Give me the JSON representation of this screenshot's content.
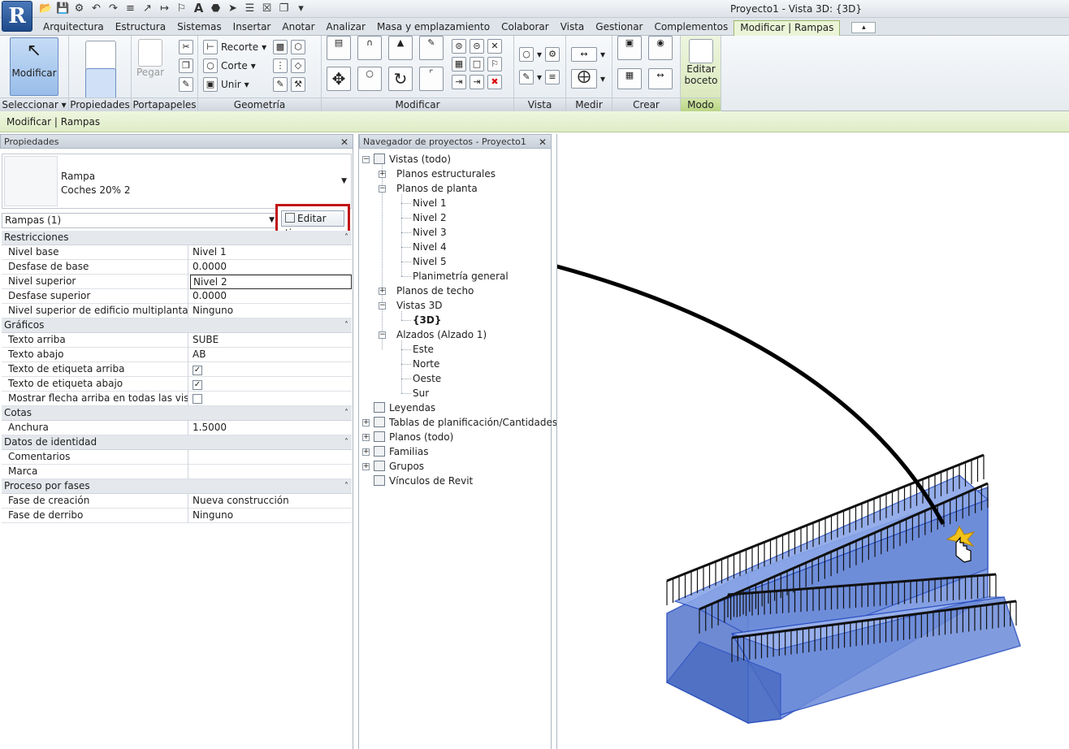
{
  "app": {
    "logo_letter": "R",
    "window_title": "Proyecto1 - Vista 3D: {3D}"
  },
  "qat": {
    "icons": [
      "open-icon",
      "save-icon",
      "sync-icon",
      "undo-icon",
      "redo-icon",
      "measure-icon",
      "dimension-icon",
      "tag-icon",
      "text-icon",
      "3d-view-icon",
      "section-icon",
      "thin-lines-icon",
      "close-hidden-icon",
      "switch-windows-icon",
      "customize-icon"
    ],
    "text_glyph": "A"
  },
  "tabs": [
    "Arquitectura",
    "Estructura",
    "Sistemas",
    "Insertar",
    "Anotar",
    "Analizar",
    "Masa y emplazamiento",
    "Colaborar",
    "Vista",
    "Gestionar",
    "Complementos",
    "Modificar | Rampas"
  ],
  "active_tab": "Modificar | Rampas",
  "ribbon": {
    "modify_label": "Modificar",
    "panels": {
      "select": "Seleccionar",
      "properties": "Propiedades",
      "clipboard": "Portapapeles",
      "geometry": "Geometría",
      "modify": "Modificar",
      "view": "Vista",
      "measure": "Medir",
      "create": "Crear",
      "mode": "Modo"
    },
    "paste_label": "Pegar",
    "cope_label": "Recorte",
    "cut_label": "Corte",
    "join_label": "Unir",
    "edit_sketch_line1": "Editar",
    "edit_sketch_line2": "boceto"
  },
  "options_bar": "Modificar | Rampas",
  "properties": {
    "header": "Propiedades",
    "type_family": "Rampa",
    "type_name": "Coches 20% 2",
    "instance_selector": "Rampas (1)",
    "edit_type_label": "Editar tipo",
    "groups": [
      {
        "title": "Restricciones",
        "rows": [
          {
            "k": "Nivel base",
            "v": "Nivel 1"
          },
          {
            "k": "Desfase de base",
            "v": "0.0000"
          },
          {
            "k": "Nivel superior",
            "v": "Nivel 2",
            "edit": true
          },
          {
            "k": "Desfase superior",
            "v": "0.0000"
          },
          {
            "k": "Nivel superior de edificio multiplanta",
            "v": "Ninguno"
          }
        ]
      },
      {
        "title": "Gráficos",
        "rows": [
          {
            "k": "Texto arriba",
            "v": "SUBE"
          },
          {
            "k": "Texto abajo",
            "v": "AB"
          },
          {
            "k": "Texto de etiqueta arriba",
            "check": true
          },
          {
            "k": "Texto de etiqueta abajo",
            "check": true
          },
          {
            "k": "Mostrar flecha arriba en todas las vistas",
            "check": false
          }
        ]
      },
      {
        "title": "Cotas",
        "rows": [
          {
            "k": "Anchura",
            "v": "1.5000"
          }
        ]
      },
      {
        "title": "Datos de identidad",
        "rows": [
          {
            "k": "Comentarios",
            "v": ""
          },
          {
            "k": "Marca",
            "v": ""
          }
        ]
      },
      {
        "title": "Proceso por fases",
        "rows": [
          {
            "k": "Fase de creación",
            "v": "Nueva construcción"
          },
          {
            "k": "Fase de derribo",
            "v": "Ninguno"
          }
        ]
      }
    ]
  },
  "browser": {
    "header": "Navegador de proyectos - Proyecto1",
    "views_all": "Vistas (todo)",
    "structural_plans": "Planos estructurales",
    "floor_plans": "Planos de planta",
    "levels": [
      "Nivel 1",
      "Nivel 2",
      "Nivel 3",
      "Nivel 4",
      "Nivel 5",
      "Planimetría general"
    ],
    "ceiling_plans": "Planos de techo",
    "views_3d": "Vistas 3D",
    "view_3d_item": "{3D}",
    "elevations": "Alzados (Alzado 1)",
    "elevation_items": [
      "Este",
      "Norte",
      "Oeste",
      "Sur"
    ],
    "legends": "Leyendas",
    "schedules": "Tablas de planificación/Cantidades",
    "sheets": "Planos (todo)",
    "families": "Familias",
    "groups": "Grupos",
    "revit_links": "Vínculos de Revit"
  },
  "colors": {
    "highlight_red": "#c01515",
    "ramp_fill": "#6f8fd8",
    "ramp_edge": "#2a4fc0",
    "active_tab_green": "#ebf4d7"
  }
}
